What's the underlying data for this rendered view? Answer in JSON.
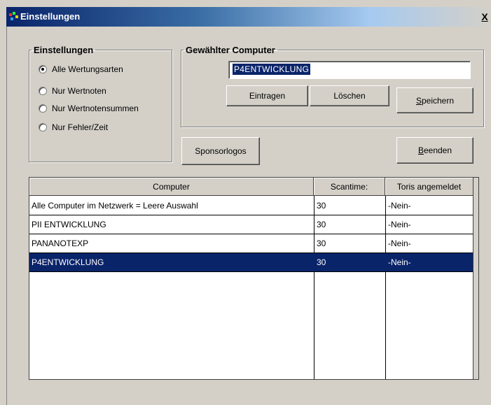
{
  "window": {
    "title": "Einstellungen",
    "close_label": "X"
  },
  "settings_group": {
    "legend": "Einstellungen",
    "options": [
      {
        "label": "Alle Wertungsarten",
        "checked": true
      },
      {
        "label": "Nur Wertnoten",
        "checked": false
      },
      {
        "label": "Nur Wertnotensummen",
        "checked": false
      },
      {
        "label": "Nur Fehler/Zeit",
        "checked": false
      }
    ]
  },
  "computer_group": {
    "legend": "Gewählter Computer",
    "value": "P4ENTWICKLUNG",
    "eintragen_label": "Eintragen",
    "loeschen_label": "Löschen",
    "speichern_label": "Speichern",
    "speichern_accel": "S",
    "speichern_rest": "peichern"
  },
  "sponsor_label": "Sponsorlogos",
  "beenden_accel": "B",
  "beenden_rest": "eenden",
  "table": {
    "columns": [
      "Computer",
      "Scantime:",
      "Toris angemeldet"
    ],
    "rows": [
      [
        "Alle Computer im Netzwerk = Leere Auswahl",
        "30",
        "-Nein-"
      ],
      [
        "PII ENTWICKLUNG",
        "30",
        "-Nein-"
      ],
      [
        "PANANOTEXP",
        "30",
        "-Nein-"
      ],
      [
        "P4ENTWICKLUNG",
        "30",
        "-Nein-"
      ]
    ],
    "selected_row": 3
  },
  "colors": {
    "face": "#d4d0c8",
    "selection": "#0a246a",
    "title_start": "#0a246a"
  },
  "icons": {
    "app": "app-icon",
    "radio": "radio-icon"
  }
}
